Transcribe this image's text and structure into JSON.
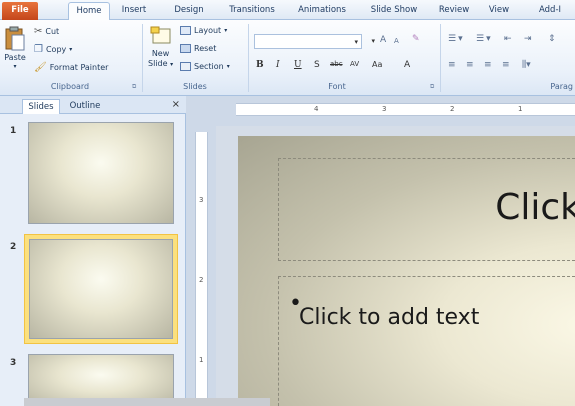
{
  "tabs": [
    "File",
    "Home",
    "Insert",
    "Design",
    "Transitions",
    "Animations",
    "Slide Show",
    "Review",
    "View",
    "Add-I"
  ],
  "clipboard": {
    "paste": "Paste",
    "cut": "Cut",
    "copy": "Copy",
    "format_painter": "Format Painter",
    "label": "Clipboard"
  },
  "slides_group": {
    "new_slide": "New",
    "new_slide2": "Slide",
    "layout": "Layout",
    "reset": "Reset",
    "section": "Section",
    "label": "Slides"
  },
  "font_group": {
    "label": "Font",
    "bold": "B",
    "italic": "I",
    "underline": "U",
    "strike": "S",
    "abc": "abc",
    "av": "AV",
    "aa": "Aa",
    "grow": "A",
    "shrink": "A",
    "color_a": "A"
  },
  "paragraph_group": {
    "label": "Parag"
  },
  "panel": {
    "tab_slides": "Slides",
    "tab_outline": "Outline",
    "close": "×",
    "slide_numbers": [
      "1",
      "2",
      "3"
    ]
  },
  "ruler": {
    "h_marks": [
      "4",
      "3",
      "2",
      "1"
    ],
    "v_marks": [
      "3",
      "2",
      "1"
    ]
  },
  "slide": {
    "title_placeholder": "Click",
    "body_placeholder": "Click to add text"
  }
}
